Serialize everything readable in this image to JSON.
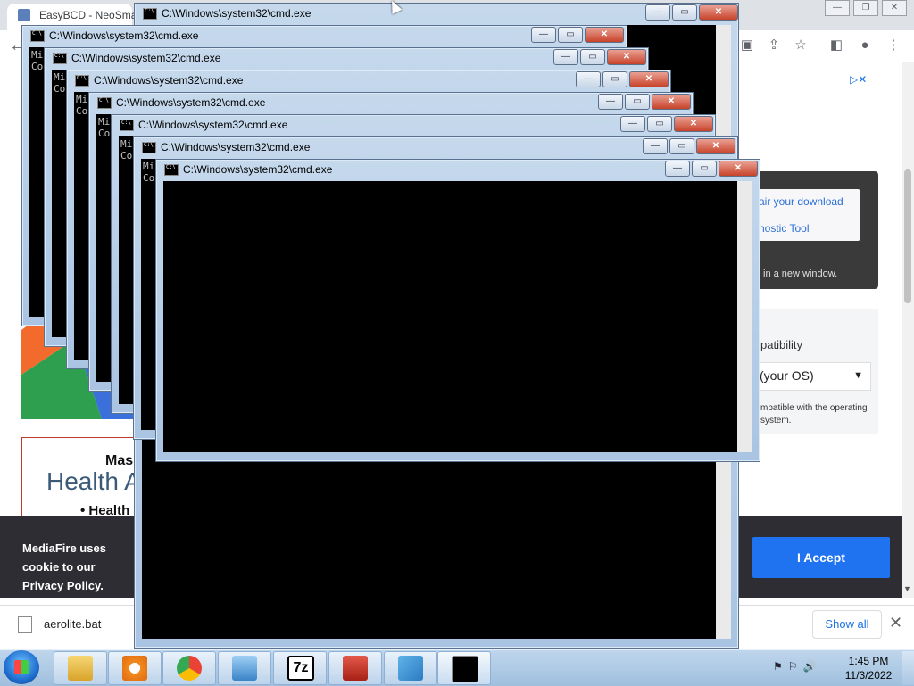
{
  "browser": {
    "tab_title": "EasyBCD - NeoSmar",
    "win_min": "—",
    "win_max": "❐",
    "win_close": "✕"
  },
  "page": {
    "ad_choices": "▷✕",
    "repair_link": "air your download",
    "diag_link": "nostic Tool",
    "new_window_text": "in a new window.",
    "compat_title": "patibility",
    "os_select_value": "(your OS)",
    "compat_note": "mpatible with the operating system.",
    "ad_mas": "Mas",
    "ad_health": "Health A",
    "ad_bullet": "• Health"
  },
  "cookie": {
    "text": "MediaFire uses cookie to our Privacy Policy.",
    "accept_label": "I Accept"
  },
  "downloads": {
    "filename": "aerolite.bat",
    "show_all": "Show all",
    "close": "✕"
  },
  "cmd": {
    "title": "C:\\Windows\\system32\\cmd.exe",
    "min": "—",
    "max": "▭",
    "close": "✕",
    "console_snippet": "Mi\nCo"
  },
  "taskbar": {
    "time": "1:45 PM",
    "date": "11/3/2022",
    "sevenzip_label": "7z"
  },
  "colors": {
    "accept": "#1f73f1",
    "cookie_bg": "#2d2d33",
    "close_button": "#c8432b"
  }
}
